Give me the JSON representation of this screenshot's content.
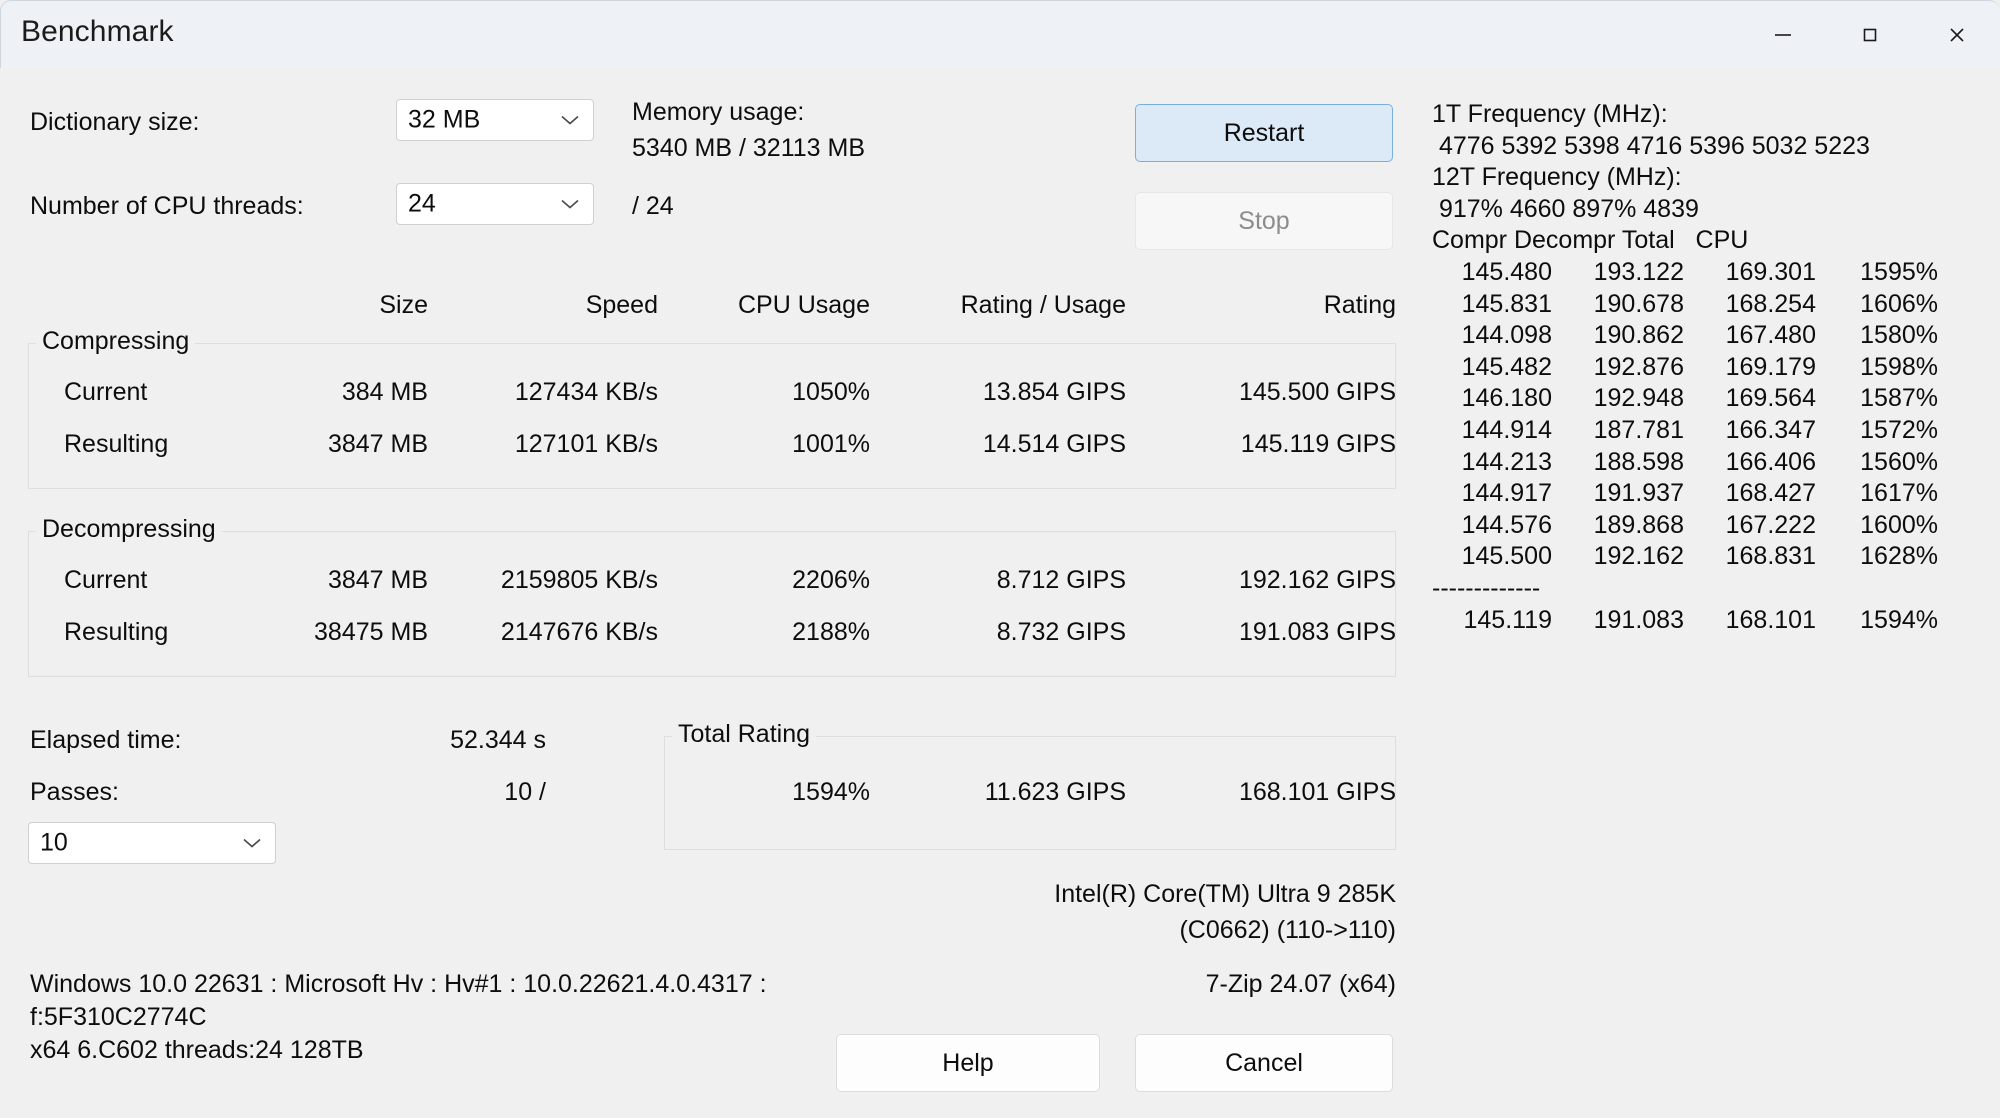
{
  "window": {
    "title": "Benchmark",
    "controls": [
      {
        "name": "minimize",
        "glyph": "minimize-icon"
      },
      {
        "name": "maximize",
        "glyph": "maximize-icon"
      },
      {
        "name": "close",
        "glyph": "close-icon"
      }
    ]
  },
  "colors": {
    "titlebar_bg": "#eef2f7",
    "body_bg": "#f0f0f0",
    "primary_btn_bg": "#dce9f7",
    "primary_btn_border": "#7aaedd",
    "disabled_text": "#8c8c8c",
    "text": "#0d0d0d",
    "groupbox_border": "#dedede"
  },
  "settings": {
    "dictionary_label": "Dictionary size:",
    "dictionary_value": "32 MB",
    "threads_label": "Number of CPU threads:",
    "threads_value": "24",
    "threads_total": "/ 24",
    "memory_label": "Memory usage:",
    "memory_value": "5340 MB / 32113 MB"
  },
  "actions": {
    "restart": "Restart",
    "stop": "Stop",
    "help": "Help",
    "cancel": "Cancel"
  },
  "results": {
    "headers": {
      "size": "Size",
      "speed": "Speed",
      "cpu_usage": "CPU Usage",
      "rating_usage": "Rating / Usage",
      "rating": "Rating"
    },
    "compressing": {
      "title": "Compressing",
      "rows": [
        {
          "label": "Current",
          "size": "384 MB",
          "speed": "127434 KB/s",
          "cpu_usage": "1050%",
          "rating_usage": "13.854 GIPS",
          "rating": "145.500 GIPS"
        },
        {
          "label": "Resulting",
          "size": "3847 MB",
          "speed": "127101 KB/s",
          "cpu_usage": "1001%",
          "rating_usage": "14.514 GIPS",
          "rating": "145.119 GIPS"
        }
      ]
    },
    "decompressing": {
      "title": "Decompressing",
      "rows": [
        {
          "label": "Current",
          "size": "3847 MB",
          "speed": "2159805 KB/s",
          "cpu_usage": "2206%",
          "rating_usage": "8.712 GIPS",
          "rating": "192.162 GIPS"
        },
        {
          "label": "Resulting",
          "size": "38475 MB",
          "speed": "2147676 KB/s",
          "cpu_usage": "2188%",
          "rating_usage": "8.732 GIPS",
          "rating": "191.083 GIPS"
        }
      ]
    }
  },
  "status": {
    "elapsed_label": "Elapsed time:",
    "elapsed_value": "52.344 s",
    "passes_label": "Passes:",
    "passes_value": "10 /",
    "passes_select_value": "10"
  },
  "total_rating": {
    "title": "Total Rating",
    "cpu_usage": "1594%",
    "rating_usage": "11.623 GIPS",
    "rating": "168.101 GIPS"
  },
  "cpu_info": {
    "line1": "Intel(R) Core(TM) Ultra 9 285K",
    "line2": "(C0662) (110->110)",
    "version": "7-Zip 24.07 (x64)"
  },
  "system_info": {
    "line1": "Windows 10.0 22631 : Microsoft Hv : Hv#1 : 10.0.22621.4.0.4317 :",
    "line2": "f:5F310C2774C",
    "line3": "x64 6.C602 threads:24 128TB"
  },
  "log": {
    "freq1t_label": "1T Frequency (MHz):",
    "freq1t_value": " 4776 5392 5398 4716 5396 5032 5223",
    "freq12t_label": "12T Frequency (MHz):",
    "freq12t_value": " 917% 4660 897% 4839",
    "columns": [
      "Compr",
      "Decompr",
      "Total",
      "CPU"
    ],
    "header_text": "Compr Decompr Total   CPU",
    "rows": [
      [
        "145.480",
        "193.122",
        "169.301",
        "1595%"
      ],
      [
        "145.831",
        "190.678",
        "168.254",
        "1606%"
      ],
      [
        "144.098",
        "190.862",
        "167.480",
        "1580%"
      ],
      [
        "145.482",
        "192.876",
        "169.179",
        "1598%"
      ],
      [
        "146.180",
        "192.948",
        "169.564",
        "1587%"
      ],
      [
        "144.914",
        "187.781",
        "166.347",
        "1572%"
      ],
      [
        "144.213",
        "188.598",
        "166.406",
        "1560%"
      ],
      [
        "144.917",
        "191.937",
        "168.427",
        "1617%"
      ],
      [
        "144.576",
        "189.868",
        "167.222",
        "1600%"
      ],
      [
        "145.500",
        "192.162",
        "168.831",
        "1628%"
      ]
    ],
    "separator": "-------------",
    "totals": [
      "145.119",
      "191.083",
      "168.101",
      "1594%"
    ]
  }
}
